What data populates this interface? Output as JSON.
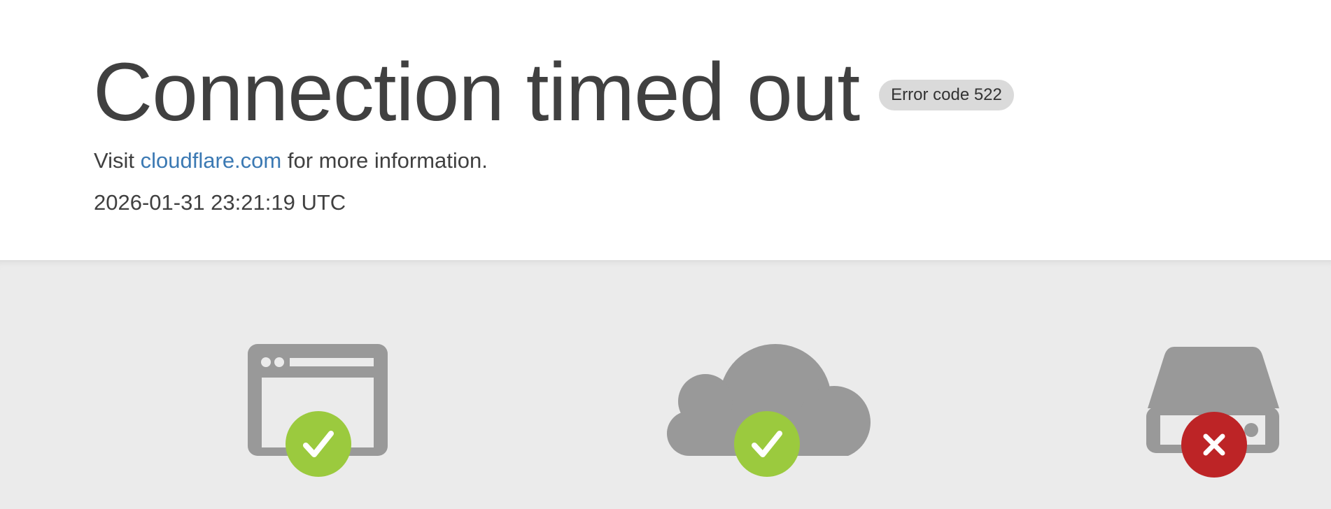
{
  "title": "Connection timed out",
  "error_badge": "Error code 522",
  "info": {
    "prefix": "Visit",
    "link_text": "cloudflare.com",
    "suffix": "for more information."
  },
  "timestamp": "2026-01-31 23:21:19 UTC",
  "colors": {
    "icon_gray": "#999999",
    "success_green": "#9bca3e",
    "error_red": "#bd2426",
    "link_blue": "#3b79b3",
    "background_gray": "#ebebeb"
  },
  "diagram": {
    "nodes": [
      {
        "icon": "browser-icon",
        "status": "ok",
        "status_icon": "check-icon"
      },
      {
        "icon": "cloud-icon",
        "status": "ok",
        "status_icon": "check-icon"
      },
      {
        "icon": "server-icon",
        "status": "error",
        "status_icon": "x-icon"
      }
    ]
  }
}
